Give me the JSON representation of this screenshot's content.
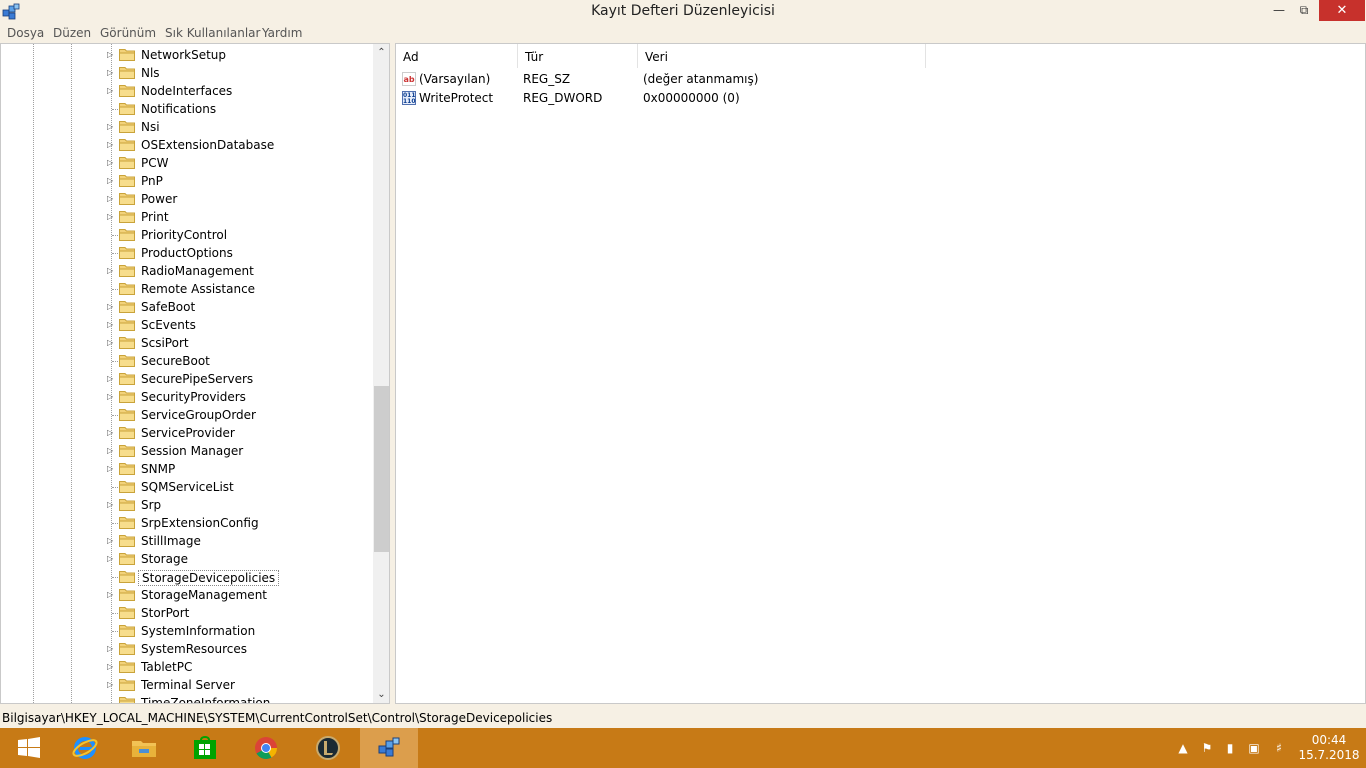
{
  "window": {
    "title": "Kayıt Defteri Düzenleyicisi",
    "minimize_icon": "minimize-icon",
    "maximize_icon": "maximize-icon",
    "close_icon": "close-icon"
  },
  "menu": [
    "Dosya",
    "Düzen",
    "Görünüm",
    "Sık Kullanılanlar",
    "Yardım"
  ],
  "tree": {
    "items": [
      {
        "label": "NetworkSetup",
        "expandable": true
      },
      {
        "label": "Nls",
        "expandable": true
      },
      {
        "label": "NodeInterfaces",
        "expandable": true
      },
      {
        "label": "Notifications",
        "expandable": false
      },
      {
        "label": "Nsi",
        "expandable": true
      },
      {
        "label": "OSExtensionDatabase",
        "expandable": true
      },
      {
        "label": "PCW",
        "expandable": true
      },
      {
        "label": "PnP",
        "expandable": true
      },
      {
        "label": "Power",
        "expandable": true
      },
      {
        "label": "Print",
        "expandable": true
      },
      {
        "label": "PriorityControl",
        "expandable": false
      },
      {
        "label": "ProductOptions",
        "expandable": false
      },
      {
        "label": "RadioManagement",
        "expandable": true
      },
      {
        "label": "Remote Assistance",
        "expandable": false
      },
      {
        "label": "SafeBoot",
        "expandable": true
      },
      {
        "label": "ScEvents",
        "expandable": true
      },
      {
        "label": "ScsiPort",
        "expandable": true
      },
      {
        "label": "SecureBoot",
        "expandable": false
      },
      {
        "label": "SecurePipeServers",
        "expandable": true
      },
      {
        "label": "SecurityProviders",
        "expandable": true
      },
      {
        "label": "ServiceGroupOrder",
        "expandable": false
      },
      {
        "label": "ServiceProvider",
        "expandable": true
      },
      {
        "label": "Session Manager",
        "expandable": true
      },
      {
        "label": "SNMP",
        "expandable": true
      },
      {
        "label": "SQMServiceList",
        "expandable": false
      },
      {
        "label": "Srp",
        "expandable": true
      },
      {
        "label": "SrpExtensionConfig",
        "expandable": false
      },
      {
        "label": "StillImage",
        "expandable": true
      },
      {
        "label": "Storage",
        "expandable": true
      },
      {
        "label": "StorageDevicepolicies",
        "expandable": false,
        "selected": true
      },
      {
        "label": "StorageManagement",
        "expandable": true
      },
      {
        "label": "StorPort",
        "expandable": false
      },
      {
        "label": "SystemInformation",
        "expandable": false
      },
      {
        "label": "SystemResources",
        "expandable": true
      },
      {
        "label": "TabletPC",
        "expandable": true
      },
      {
        "label": "Terminal Server",
        "expandable": true
      },
      {
        "label": "TimeZoneInformation",
        "expandable": false
      }
    ],
    "scroll_up_icon": "scroll-up-icon",
    "scroll_down_icon": "scroll-down-icon"
  },
  "values_list": {
    "columns": [
      "Ad",
      "Tür",
      "Veri"
    ],
    "rows": [
      {
        "icon": "string-value-icon",
        "name": "(Varsayılan)",
        "type": "REG_SZ",
        "data": "(değer atanmamış)"
      },
      {
        "icon": "dword-value-icon",
        "name": "WriteProtect",
        "type": "REG_DWORD",
        "data": "0x00000000 (0)"
      }
    ]
  },
  "status": {
    "path": "Bilgisayar\\HKEY_LOCAL_MACHINE\\SYSTEM\\CurrentControlSet\\Control\\StorageDevicepolicies"
  },
  "taskbar": {
    "apps": [
      "start-icon",
      "internet-explorer-icon",
      "file-explorer-icon",
      "store-icon",
      "chrome-icon",
      "league-of-legends-icon",
      "registry-editor-icon"
    ],
    "active_app": "registry-editor-icon",
    "tray": [
      "show-hidden-icons-icon",
      "action-center-icon",
      "power-icon",
      "network-icon",
      "volume-icon"
    ],
    "time": "00:44",
    "date": "15.7.2018"
  },
  "colors": {
    "taskbar": "#c77a16",
    "taskbar_active": "#dc9e4c",
    "window_frame": "#f6f0e4",
    "close_button": "#c7312c"
  }
}
